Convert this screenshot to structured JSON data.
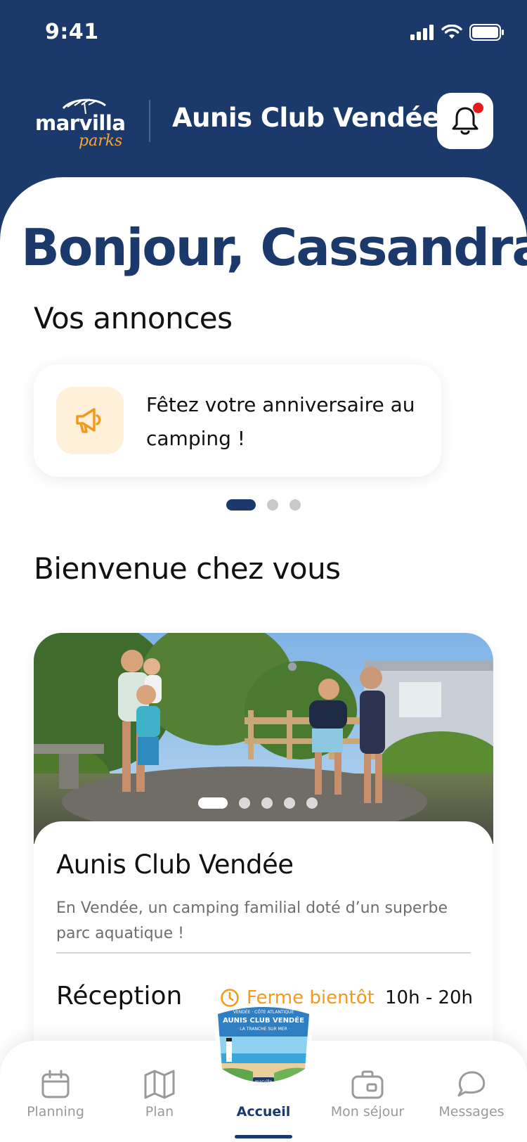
{
  "status_bar": {
    "time": "9:41"
  },
  "header": {
    "logo_word": "marvilla",
    "logo_sub": "parks",
    "park_name": "Aunis Club Vendée"
  },
  "greeting": "Bonjour, Cassandra",
  "announcements": {
    "title": "Vos annonces",
    "items": [
      {
        "text": "Fêtez votre anniversaire au camping !",
        "icon": "megaphone-icon"
      }
    ],
    "page_count": 3,
    "active_page": 1
  },
  "welcome": {
    "title": "Bienvenue chez vous",
    "photo_count": 5,
    "active_photo": 1,
    "card_title": "Aunis Club Vendée",
    "card_desc": "En Vendée, un camping familial doté d’un superbe parc aquatique !",
    "reception": {
      "label": "Réception",
      "status": "Ferme bientôt",
      "hours": "10h - 20h"
    }
  },
  "badge": {
    "line1": "VENDÉE · CÔTE ATLANTIQUE",
    "line2": "AUNIS CLUB VENDÉE",
    "line3": "· LA TRANCHE SUR MER ·",
    "line4": "marvilla"
  },
  "tabs": [
    {
      "label": "Planning",
      "icon": "calendar-icon"
    },
    {
      "label": "Plan",
      "icon": "map-icon"
    },
    {
      "label": "Accueil",
      "icon": "home-badge"
    },
    {
      "label": "Mon séjour",
      "icon": "suitcase-icon"
    },
    {
      "label": "Messages",
      "icon": "chat-icon"
    }
  ],
  "colors": {
    "brand_navy": "#1b3a6b",
    "accent_orange": "#f39a1e",
    "notification_red": "#e31b1b"
  }
}
